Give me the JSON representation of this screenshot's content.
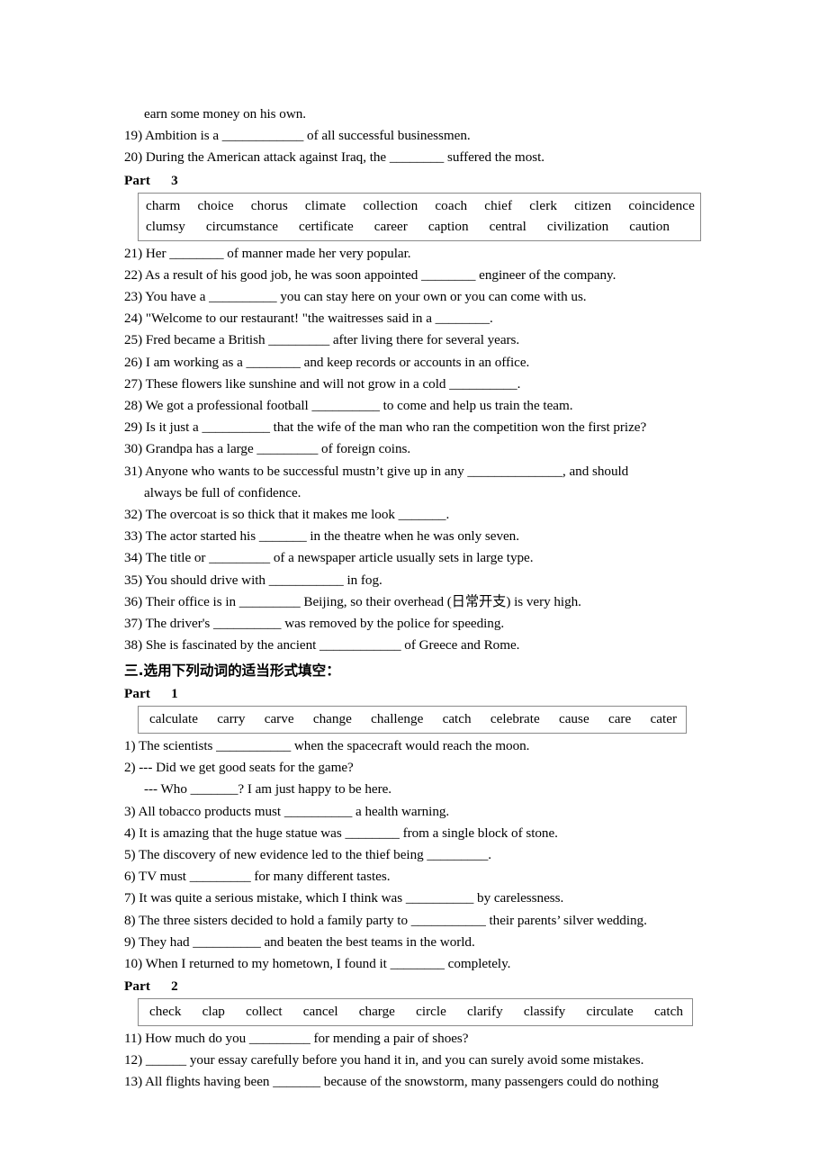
{
  "document": {
    "carryover_line": "earn some money on his own.",
    "items_continued": [
      "19) Ambition is a ____________ of all successful businessmen.",
      "20) During the American attack against Iraq, the ________ suffered the most."
    ],
    "part3": {
      "heading_word": "Part",
      "heading_number": "3",
      "wordbank_row1": [
        "charm",
        "choice",
        "chorus",
        "climate",
        "collection",
        "coach",
        "chief",
        "clerk",
        "citizen",
        "coincidence"
      ],
      "wordbank_row2": [
        "clumsy",
        "circumstance",
        "certificate",
        "career",
        "caption",
        "central",
        "civilization",
        "caution"
      ],
      "items": [
        "21) Her ________ of manner made her very popular.",
        "22) As a result of his good job, he was soon appointed ________ engineer of the company.",
        "23) You have a __________ you can stay here on your own or you can come with us.",
        "24) \"Welcome to our restaurant! \"the waitresses said in a ________.",
        "25) Fred became a British _________ after living there for several years.",
        "26) I am working as a ________ and keep records or accounts in an office.",
        "27) These flowers like sunshine and will not grow in a cold __________.",
        "28) We got a professional football __________ to come and help us train the team.",
        "29) Is it just a __________ that the wife of the man who ran the competition won the first prize?",
        "30) Grandpa has a large _________ of foreign coins."
      ],
      "item31_line1": "31) Anyone who wants to be successful mustn’t give up in any ______________, and should",
      "item31_line2": "always be full of confidence.",
      "items_after": [
        "32) The overcoat is so thick that it makes me look _______.",
        "33) The actor started his _______ in the theatre when he was only seven.",
        "34) The title or _________ of a newspaper article usually sets in large type.",
        "35) You should drive with ___________ in fog.",
        "36) Their office is in _________ Beijing, so their overhead (日常开支) is very high.",
        "37) The driver's __________ was removed by the police for speeding.",
        "38) She is fascinated by the ancient ____________ of Greece and Rome."
      ]
    },
    "section3": {
      "heading": "三.选用下列动词的适当形式填空：",
      "part1": {
        "heading_word": "Part",
        "heading_number": "1",
        "wordbank": [
          "calculate",
          "carry",
          "carve",
          "change",
          "challenge",
          "catch",
          "celebrate",
          "cause",
          "care",
          "cater"
        ],
        "items": [
          "1) The scientists ___________ when the spacecraft would reach the moon.",
          "2) --- Did we get good seats for the game?",
          "--- Who _______? I am just happy to be here.",
          "3) All tobacco products must __________ a health warning.",
          "4) It is amazing that the huge statue was ________ from a single block of stone.",
          "5) The discovery of new evidence led to the thief being _________.",
          "6) TV must _________ for many different tastes.",
          "7) It was quite a serious mistake, which I think was __________ by carelessness.",
          "8) The three sisters decided to hold a family party to ___________ their parents’ silver wedding.",
          "9) They had __________ and beaten the best teams in the world.",
          "10) When I returned to my hometown, I found it ________ completely."
        ]
      },
      "part2": {
        "heading_word": "Part",
        "heading_number": "2",
        "wordbank": [
          "check",
          "clap",
          "collect",
          "cancel",
          "charge",
          "circle",
          "clarify",
          "classify",
          "circulate",
          "catch"
        ],
        "items": [
          "11) How much do you _________ for mending a pair of shoes?",
          "12) ______ your essay carefully before you hand it in, and you can surely avoid some mistakes.",
          "13) All flights having been _______ because of the snowstorm, many passengers could do nothing"
        ]
      }
    }
  }
}
